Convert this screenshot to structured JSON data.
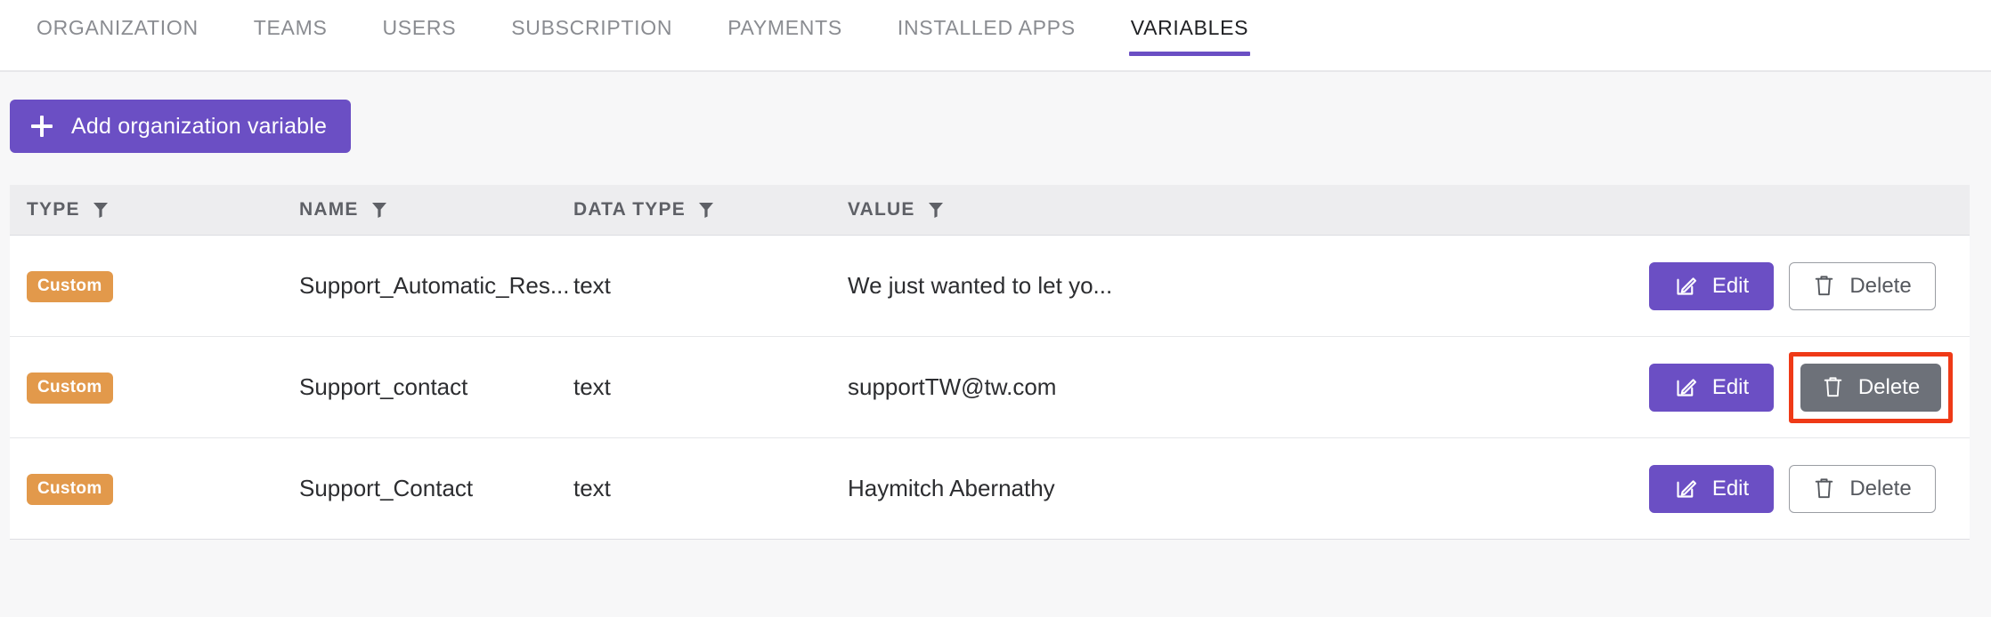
{
  "tabs": [
    {
      "label": "ORGANIZATION",
      "active": false
    },
    {
      "label": "TEAMS",
      "active": false
    },
    {
      "label": "USERS",
      "active": false
    },
    {
      "label": "SUBSCRIPTION",
      "active": false
    },
    {
      "label": "PAYMENTS",
      "active": false
    },
    {
      "label": "INSTALLED APPS",
      "active": false
    },
    {
      "label": "VARIABLES",
      "active": true
    }
  ],
  "toolbar": {
    "add_label": "Add organization variable",
    "add_icon": "plus-icon"
  },
  "table": {
    "headers": {
      "type": "TYPE",
      "name": "NAME",
      "data_type": "DATA TYPE",
      "value": "VALUE"
    },
    "filter_icon": "filter-funnel-icon",
    "rows": [
      {
        "type": "Custom",
        "name": "Support_Automatic_Res...",
        "data_type": "text",
        "value": "We just wanted to let yo...",
        "edit_label": "Edit",
        "delete_label": "Delete",
        "edit_icon": "edit-pencil-square-icon",
        "delete_icon": "trash-icon",
        "delete_hovered": false,
        "delete_highlighted": false
      },
      {
        "type": "Custom",
        "name": "Support_contact",
        "data_type": "text",
        "value": "supportTW@tw.com",
        "edit_label": "Edit",
        "delete_label": "Delete",
        "edit_icon": "edit-pencil-square-icon",
        "delete_icon": "trash-icon",
        "delete_hovered": true,
        "delete_highlighted": true
      },
      {
        "type": "Custom",
        "name": "Support_Contact",
        "data_type": "text",
        "value": "Haymitch Abernathy",
        "edit_label": "Edit",
        "delete_label": "Delete",
        "edit_icon": "edit-pencil-square-icon",
        "delete_icon": "trash-icon",
        "delete_hovered": false,
        "delete_highlighted": false
      }
    ]
  },
  "colors": {
    "accent_purple": "#6b4fc4",
    "badge_orange": "#e2994b",
    "highlight_red": "#ef3a17",
    "header_bg": "#ededef",
    "page_bg": "#f7f7f8",
    "delete_hover_bg": "#6d7179"
  }
}
